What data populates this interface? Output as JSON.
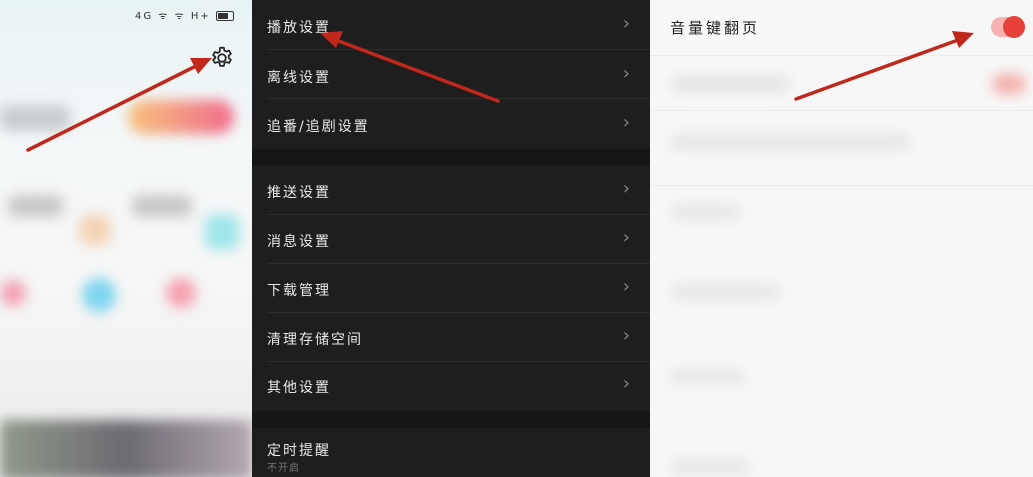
{
  "left_panel": {
    "status_bar": {
      "network": "4G",
      "signals": "ᯤ ᯤ",
      "extra": "H+"
    },
    "settings_icon": "gear-icon"
  },
  "settings_list": {
    "group1": [
      {
        "label": "播放设置"
      },
      {
        "label": "离线设置"
      },
      {
        "label": "追番/追剧设置"
      }
    ],
    "group2": [
      {
        "label": "推送设置"
      },
      {
        "label": "消息设置"
      },
      {
        "label": "下载管理"
      },
      {
        "label": "清理存储空间"
      },
      {
        "label": "其他设置"
      }
    ],
    "group3": {
      "label": "定时提醒",
      "sublabel": "不开启"
    },
    "chevron": "›"
  },
  "player_settings": {
    "volume_key_page_turn": {
      "label": "音量键翻页",
      "enabled": true
    }
  },
  "colors": {
    "arrow": "#c0281c",
    "toggle_on": "#e8413a"
  }
}
